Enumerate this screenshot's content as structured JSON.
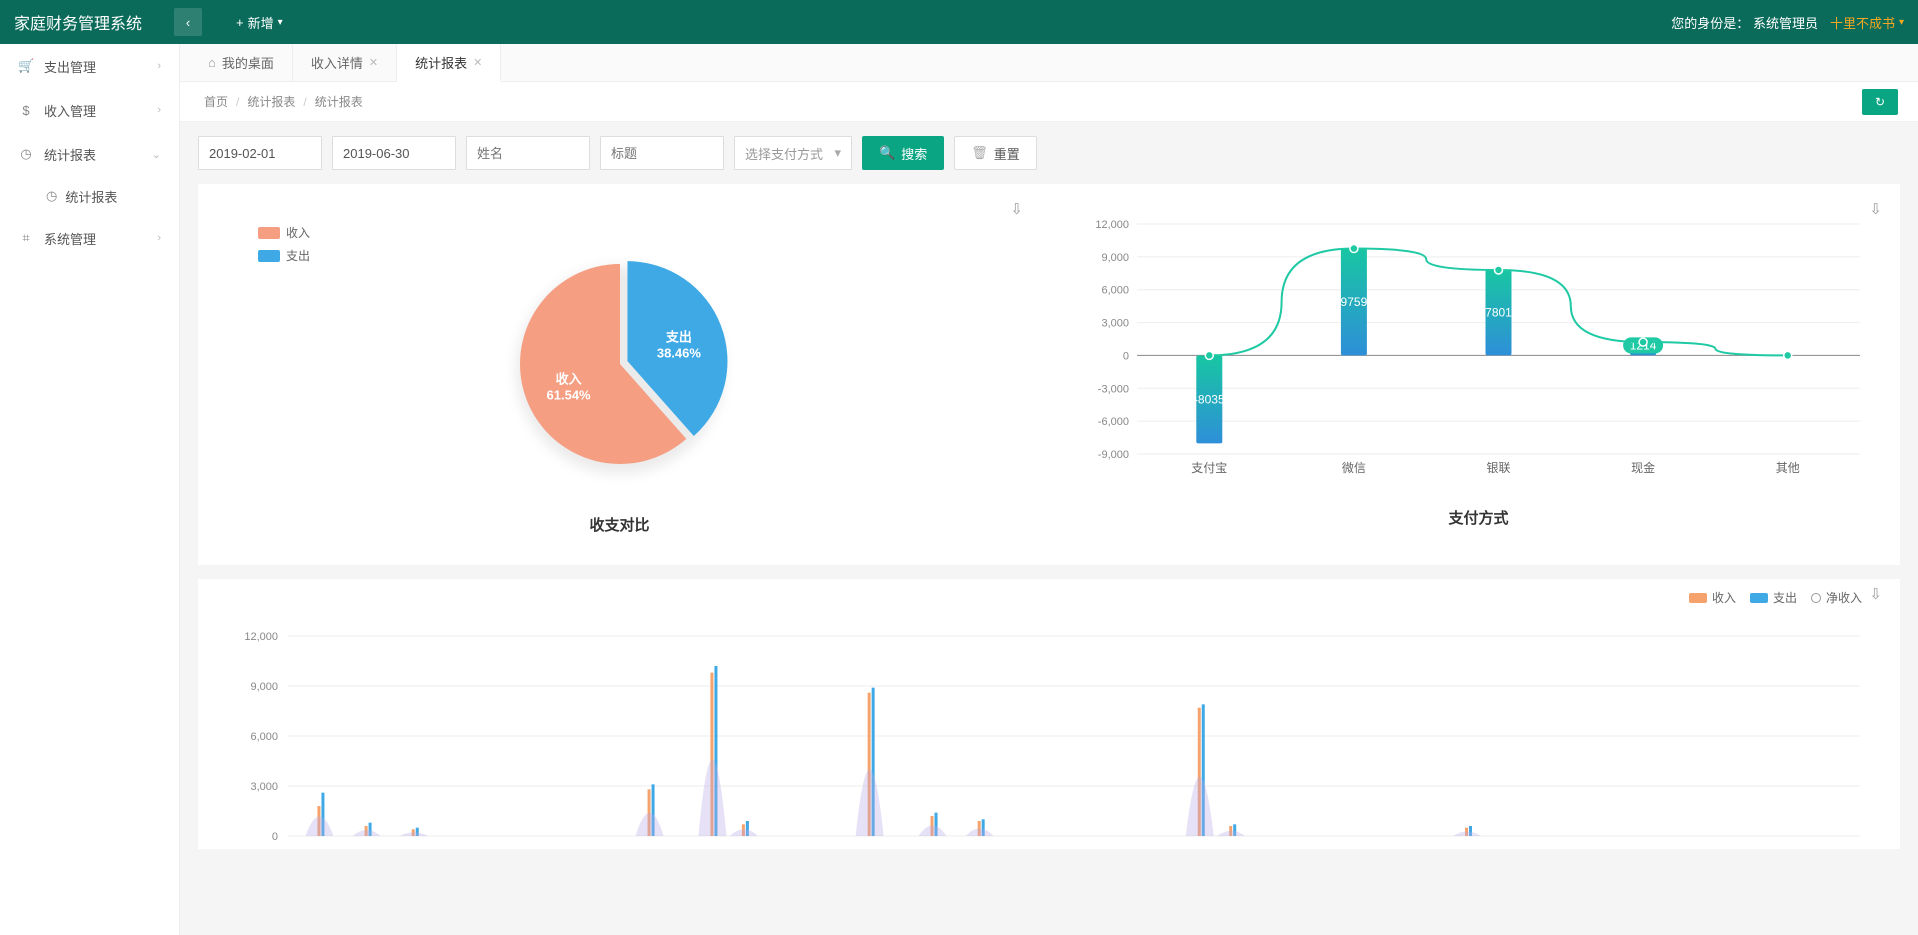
{
  "header": {
    "brand": "家庭财务管理系统",
    "add_label": "新增",
    "role_label": "您的身份是：",
    "role_value": "系统管理员",
    "user_name": "十里不成书"
  },
  "sidebar": {
    "items": [
      {
        "icon": "cart",
        "label": "支出管理",
        "arrow": "›"
      },
      {
        "icon": "dollar",
        "label": "收入管理",
        "arrow": "›"
      },
      {
        "icon": "clock",
        "label": "统计报表",
        "arrow": "⌄",
        "expanded": true,
        "children": [
          {
            "icon": "clock",
            "label": "统计报表"
          }
        ]
      },
      {
        "icon": "grid",
        "label": "系统管理",
        "arrow": "›"
      }
    ]
  },
  "tabs": [
    {
      "icon": "home",
      "label": "我的桌面",
      "closable": false
    },
    {
      "icon": "",
      "label": "收入详情",
      "closable": true
    },
    {
      "icon": "",
      "label": "统计报表",
      "closable": true,
      "active": true
    }
  ],
  "breadcrumbs": [
    "首页",
    "统计报表",
    "统计报表"
  ],
  "filters": {
    "date_start": "2019-02-01",
    "date_end": "2019-06-30",
    "name_placeholder": "姓名",
    "title_placeholder": "标题",
    "paytype_placeholder": "选择支付方式",
    "search_label": "搜索",
    "reset_label": "重置"
  },
  "chart_data": [
    {
      "type": "pie",
      "title": "收支对比",
      "legend": [
        "收入",
        "支出"
      ],
      "slices": [
        {
          "name": "收入",
          "percent": 61.54,
          "color": "#f59e82"
        },
        {
          "name": "支出",
          "percent": 38.46,
          "color": "#3fa9e6"
        }
      ]
    },
    {
      "type": "bar",
      "title": "支付方式",
      "categories": [
        "支付宝",
        "微信",
        "银联",
        "现金",
        "其他"
      ],
      "values": [
        -8035,
        9759,
        7801,
        1214,
        0
      ],
      "ylim": [
        -9000,
        12000
      ],
      "ytick": 3000,
      "bar_gradient": [
        "#18c6a2",
        "#2e8fd8"
      ]
    },
    {
      "type": "bar",
      "title": "",
      "legend": [
        "收入",
        "支出",
        "净收入"
      ],
      "ylim": [
        0,
        12000
      ],
      "ytick": 3000,
      "colors": {
        "income": "#f5a26c",
        "expense": "#3fa9e6",
        "net": "#b8a8e6"
      },
      "series_note": "daily series partially visible"
    }
  ]
}
